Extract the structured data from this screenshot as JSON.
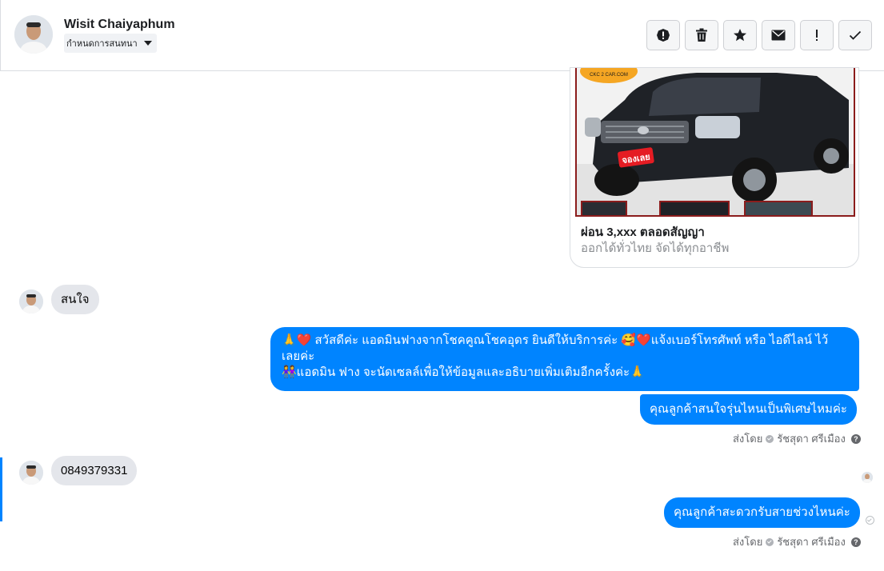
{
  "header": {
    "contact_name": "Wisit Chaiyaphum",
    "assign_label": "กำหนดการสนทนา",
    "actions": [
      "alert-icon",
      "trash-icon",
      "star-icon",
      "envelope-icon",
      "exclamation-icon",
      "check-icon"
    ]
  },
  "card": {
    "badge": "CKC 2 CAR.COM",
    "stamp": "จองเลย",
    "title": "ผ่อน 3,xxx ตลอดสัญญา",
    "subtitle": "ออกได้ทั่วไทย จัดได้ทุกอาชีพ"
  },
  "messages": [
    {
      "from": "customer",
      "text": "สนใจ"
    },
    {
      "from": "page",
      "lines": [
        "🙏❤️ สวัสดีค่ะ แอดมินฟางจากโชคคูณโชคอุดร ยินดีให้บริการค่ะ 🥰❤️แจ้งเบอร์โทรศัพท์ หรือ ไอดีไลน์  ไว้",
        "เลยค่ะ",
        "👭แอดมิน ฟาง จะนัดเซลล์เพื่อให้ข้อมูลและอธิบายเพิ่มเติมอีกครั้งค่ะ🙏"
      ]
    },
    {
      "from": "page",
      "text": "คุณลูกค้าสนใจรุ่นไหนเป็นพิเศษไหมค่ะ"
    },
    {
      "from": "customer",
      "text": "0849379331"
    },
    {
      "from": "page",
      "text": "คุณลูกค้าสะดวกรับสายช่วงไหนค่ะ"
    }
  ],
  "sent_by": {
    "prefix": "ส่งโดย",
    "agent": "รัชสุดา ศรีเมือง",
    "help": "?"
  },
  "colors": {
    "accent": "#0084ff",
    "incoming_bubble": "#e4e6eb"
  }
}
